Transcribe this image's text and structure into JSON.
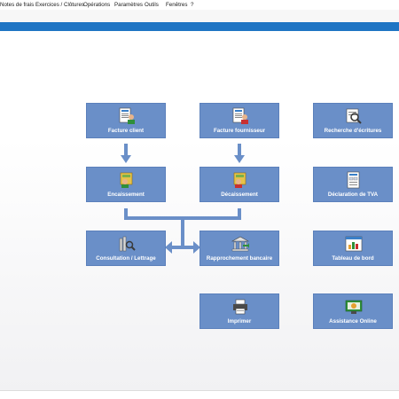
{
  "menu": {
    "items": [
      "Notes de frais",
      "Exercices / Clôtures",
      "Opérations",
      "Paramètres",
      "Outils",
      "Fenêtres",
      "?"
    ]
  },
  "tiles": {
    "facture_client": "Facture client",
    "facture_fournisseur": "Facture fournisseur",
    "recherche_ecritures": "Recherche d'écritures",
    "encaissement": "Encaissement",
    "decaissement": "Décaissement",
    "declaration_tva": "Déclaration de TVA",
    "consultation_lettrage": "Consultation / Lettrage",
    "rapprochement_bancaire": "Rapprochement bancaire",
    "tableau_de_bord": "Tableau de bord",
    "imprimer": "Imprimer",
    "assistance_online": "Assistance Online"
  },
  "colors": {
    "accent_bar": "#1f75c4",
    "tile_bg": "#6a8fc8",
    "arrow": "#6a8fc8"
  }
}
